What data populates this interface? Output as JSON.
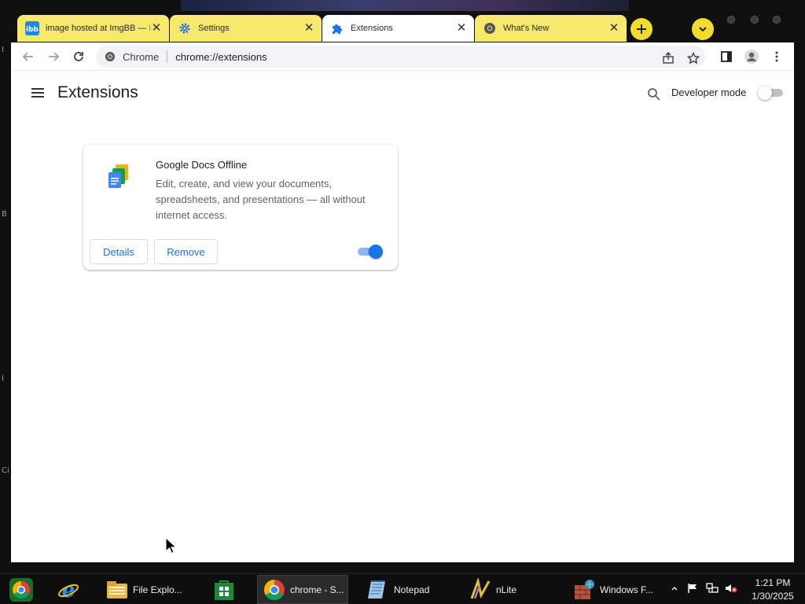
{
  "browser": {
    "tabs": [
      {
        "title": "image hosted at ImgBB — Im",
        "icon": "imgbb-icon",
        "active": false
      },
      {
        "title": "Settings",
        "icon": "gear-icon",
        "active": false
      },
      {
        "title": "Extensions",
        "icon": "puzzle-piece-icon",
        "active": true
      },
      {
        "title": "What's New",
        "icon": "chrome-icon",
        "active": false
      }
    ],
    "new_tab_icon": "plus-icon",
    "tab_search_icon": "chevron-down-icon",
    "omnibox": {
      "site_label": "Chrome",
      "url": "chrome://extensions"
    },
    "toolbar_icons": [
      "back-arrow-icon",
      "forward-arrow-icon",
      "reload-icon",
      "share-icon",
      "star-icon",
      "side-panel-icon",
      "profile-icon",
      "more-vert-icon"
    ]
  },
  "page": {
    "title": "Extensions",
    "developer_mode_label": "Developer mode",
    "developer_mode_enabled": false,
    "extensions": [
      {
        "name": "Google Docs Offline",
        "description": "Edit, create, and view your documents, spreadsheets, and presentations — all without internet access.",
        "details_label": "Details",
        "remove_label": "Remove",
        "enabled": true
      }
    ]
  },
  "taskbar": {
    "items": [
      {
        "label": "",
        "icon": "internet-explorer-icon"
      },
      {
        "label": "File Explo...",
        "icon": "file-explorer-icon"
      },
      {
        "label": "",
        "icon": "store-icon"
      },
      {
        "label": "chrome - S...",
        "icon": "chrome-icon"
      },
      {
        "label": "Notepad",
        "icon": "notepad-icon"
      },
      {
        "label": "nLite",
        "icon": "nlite-icon"
      },
      {
        "label": "Windows F...",
        "icon": "windows-firewall-icon"
      }
    ],
    "clock": {
      "time": "1:21 PM",
      "date": "1/30/2025"
    }
  },
  "desktop": {
    "edge_marks": [
      "I",
      "B",
      "I",
      "Ci"
    ]
  },
  "colors": {
    "tab_yellow": "#f7e86e",
    "accent_blue": "#1a73e8",
    "taskbar": "#0e0e0e"
  }
}
